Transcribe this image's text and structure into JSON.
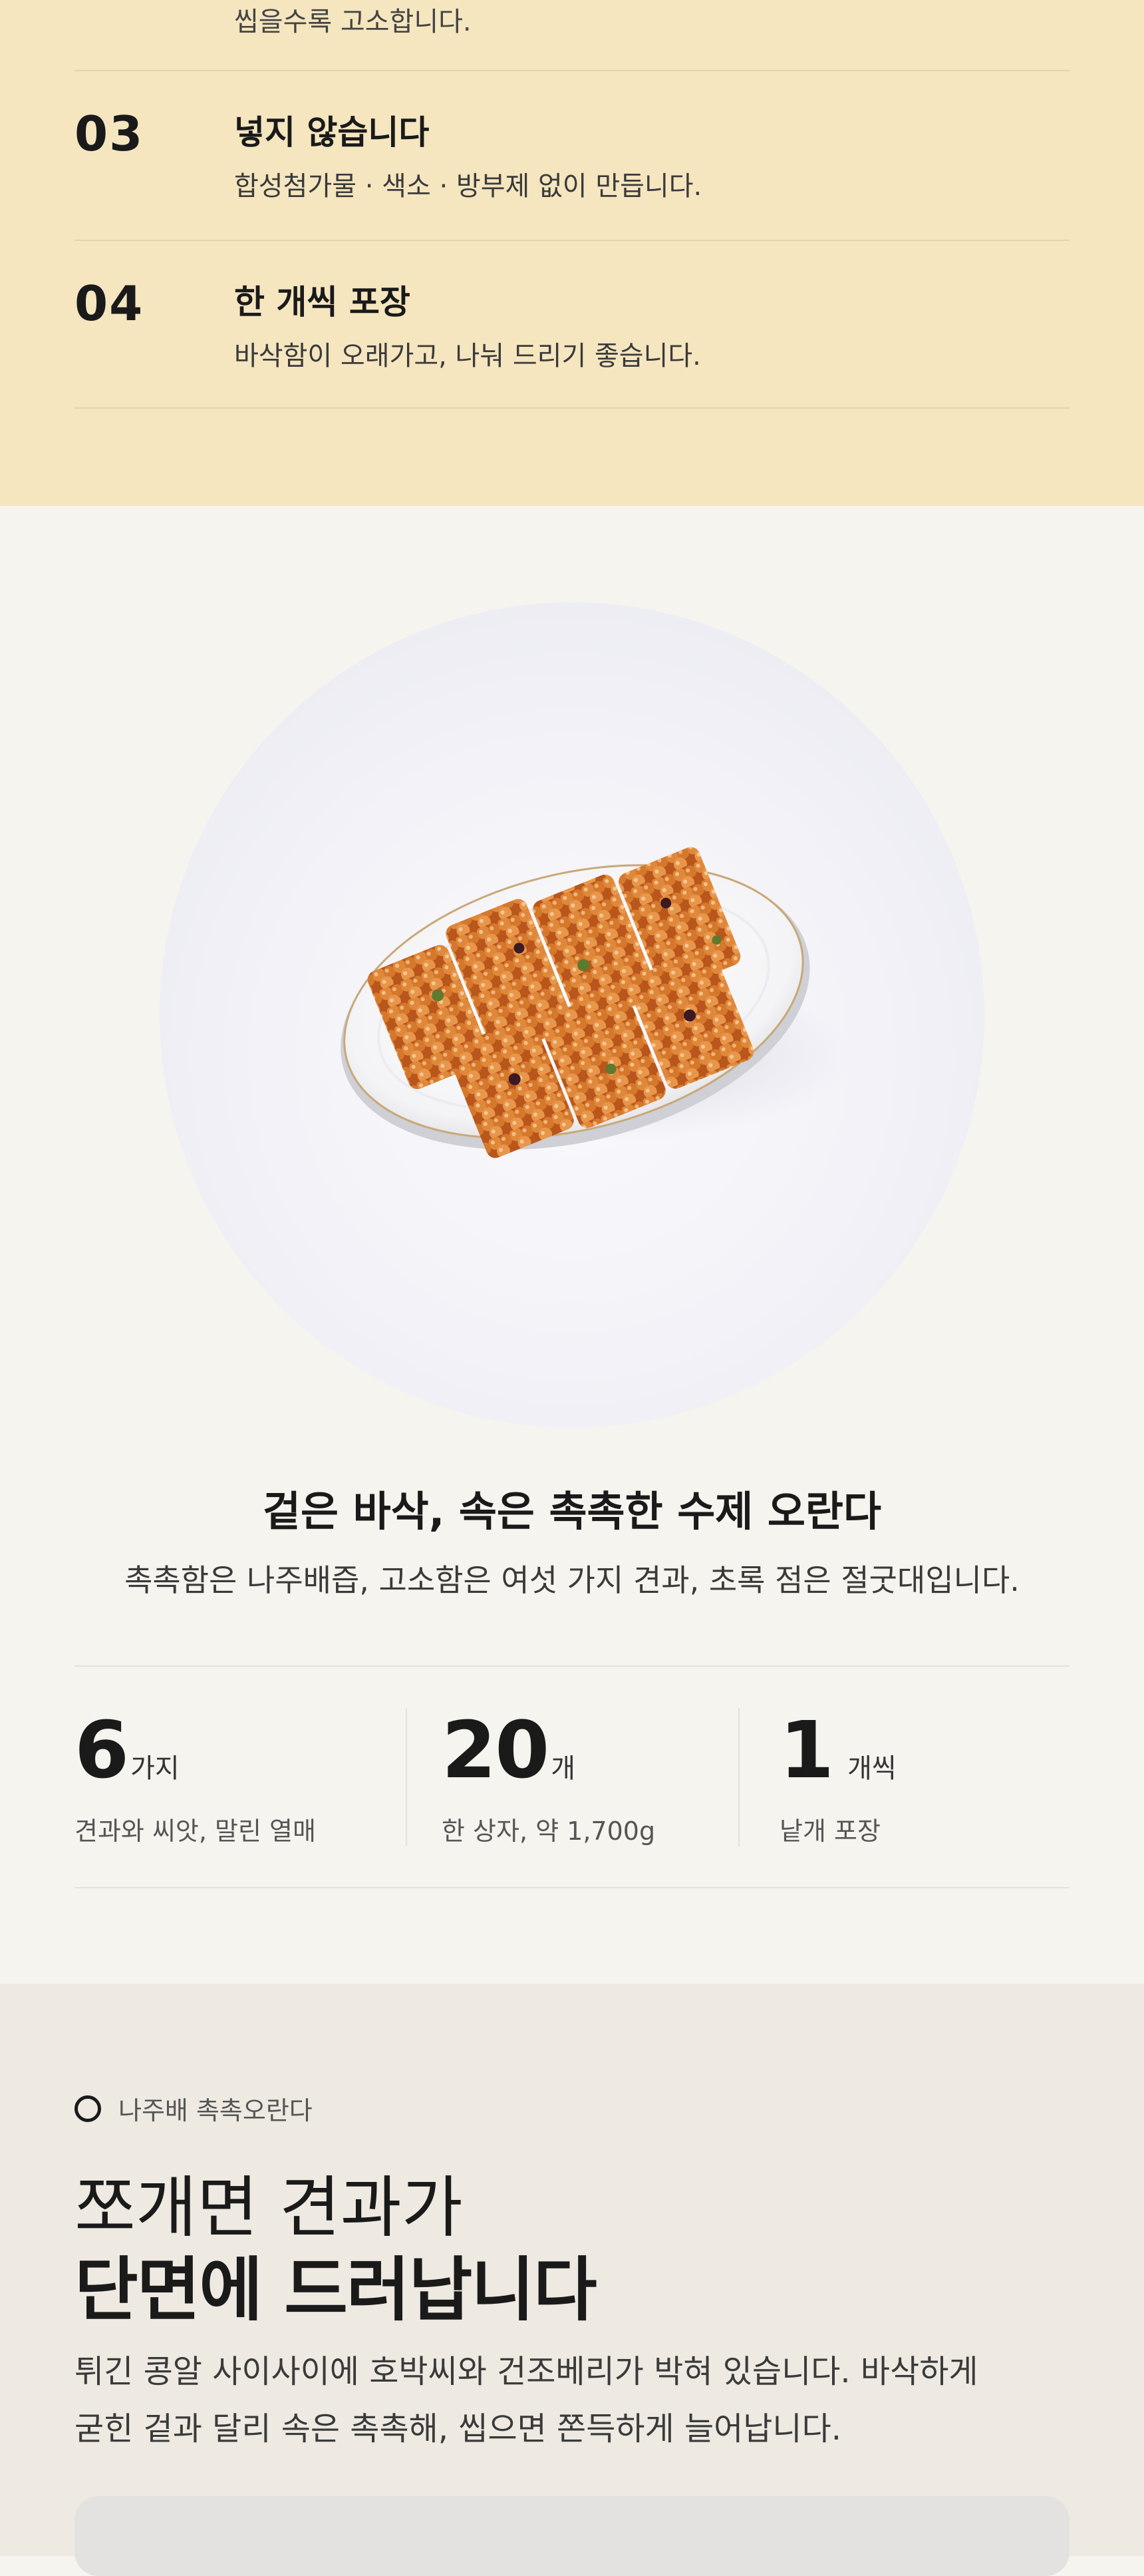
{
  "features": {
    "top_text": "씹을수록 고소합니다.",
    "items": [
      {
        "num": "03",
        "title": "넣지 않습니다",
        "desc": "합성첨가물 · 색소 · 방부제 없이 만듭니다."
      },
      {
        "num": "04",
        "title": "한 개씩 포장",
        "desc": "바삭함이 오래가고, 나눠 드리기 좋습니다."
      }
    ]
  },
  "product": {
    "title": "겉은 바삭, 속은 촉촉한 수제 오란다",
    "subtitle": "촉촉함은 나주배즙, 고소함은 여섯 가지 견과, 초록 점은 절굿대입니다.",
    "stats": [
      {
        "value": "6",
        "unit": "가지",
        "desc": "견과와 씨앗, 말린 열매"
      },
      {
        "value": "20",
        "unit": "개",
        "desc": "한 상자, 약 1,700g"
      },
      {
        "value": "1",
        "unit": "개씩",
        "desc": "낱개 포장"
      }
    ]
  },
  "story": {
    "eyebrow": "나주배 촉촉오란다",
    "heading_line1": "쪼개면 견과가",
    "heading_line2": "단면에 드러납니다",
    "paragraph_line1": "튀긴 콩알 사이사이에 호박씨와 건조베리가 박혀 있습니다. 바삭하게",
    "paragraph_line2": "굳힌 겉과 달리 속은 촉촉해, 씹으면 쫀득하게 늘어납니다."
  },
  "colors": {
    "features_bg": "#f5e6c0",
    "product_bg": "#f6f4ef",
    "story_bg": "#eeeae2",
    "text": "#1a1a1a"
  }
}
